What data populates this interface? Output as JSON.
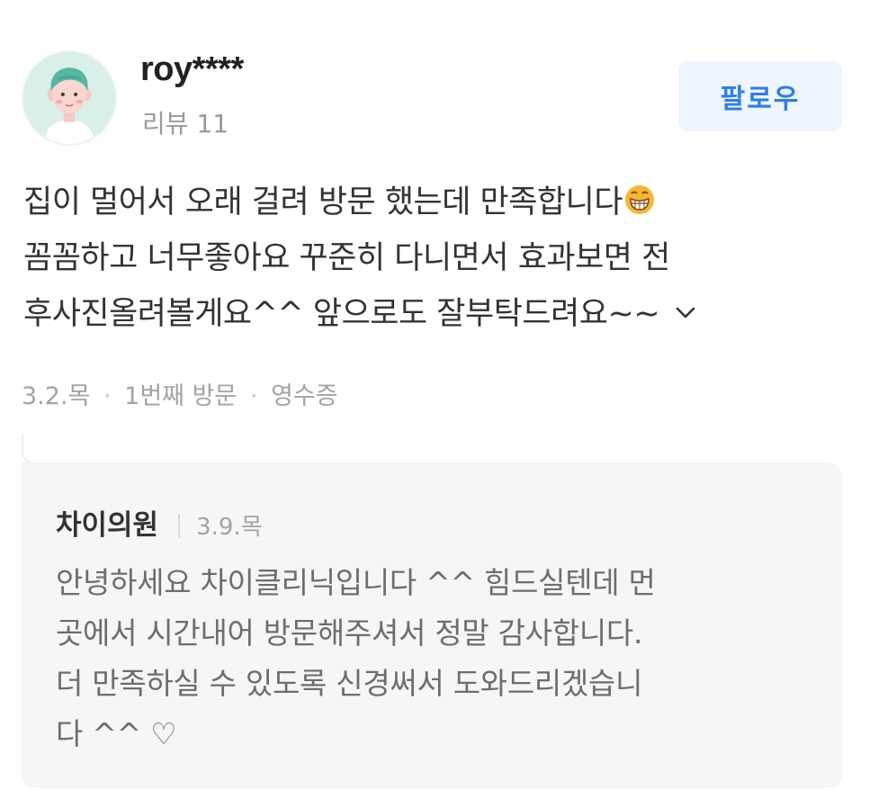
{
  "review": {
    "username": "roy****",
    "review_count": "리뷰 11",
    "follow_label": "팔로우",
    "body_lines": [
      "집이 멀어서 오래 걸려 방문 했는데 만족합니다",
      "꼼꼼하고 너무좋아요 꾸준히 다니면서 효과보면 전",
      "후사진올려볼게요^^ 앞으로도 잘부탁드려요~~"
    ],
    "meta": {
      "date": "3.2.목",
      "visit": "1번째 방문",
      "verification": "영수증",
      "separator": "·"
    }
  },
  "reply": {
    "author": "차이의원",
    "date": "3.9.목",
    "lines": [
      "안녕하세요 차이클리닉입니다 ^^ 힘드실텐데 먼",
      "곳에서 시간내어 방문해주셔서 정말 감사합니다.",
      "더 만족하실 수 있도록 신경써서 도와드리겠습니",
      "다 ^^ ♡"
    ]
  },
  "icons": {
    "avatar": "user-avatar-illustration",
    "emoji": "grinning-face-icon",
    "expand": "chevron-down-icon"
  },
  "colors": {
    "accent": "#2f7ee8",
    "follow_bg": "#eef5ff",
    "reply_bg": "#f4f6f8",
    "avatar_bg": "#d9efe9"
  }
}
